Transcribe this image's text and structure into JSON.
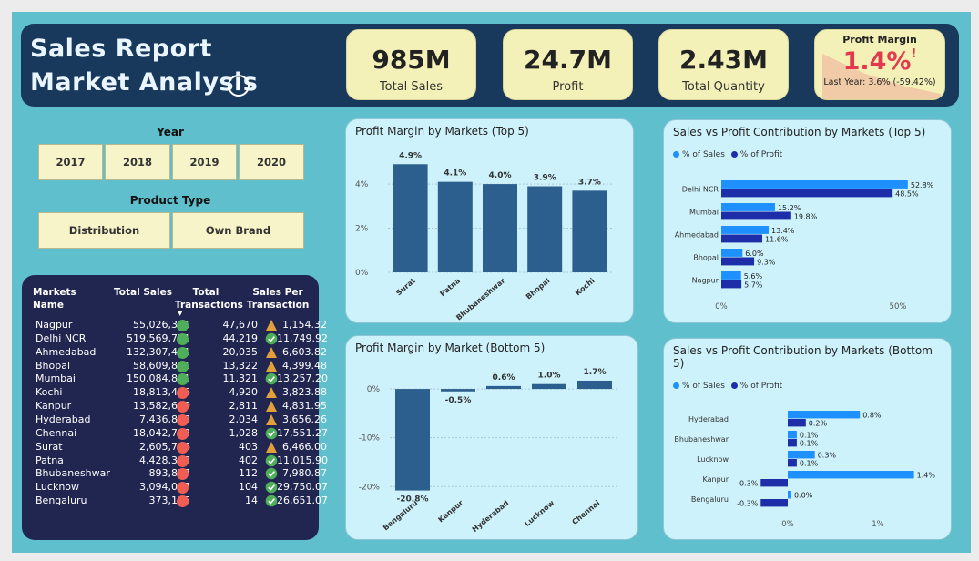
{
  "header": {
    "title_line1": "Sales Report",
    "title_line2": "Market Analysis",
    "info_icon": "i"
  },
  "kpis": [
    {
      "value": "985M",
      "label": "Total Sales"
    },
    {
      "value": "24.7M",
      "label": "Profit"
    },
    {
      "value": "2.43M",
      "label": "Total Quantity"
    }
  ],
  "profit_margin_card": {
    "title": "Profit Margin",
    "value": "1.4%",
    "alert": "!",
    "last_year": "Last Year: 3.6% (-59.42%)"
  },
  "year_slicer": {
    "title": "Year",
    "options": [
      "2017",
      "2018",
      "2019",
      "2020"
    ]
  },
  "product_slicer": {
    "title": "Product Type",
    "options": [
      "Distribution",
      "Own Brand"
    ]
  },
  "markets_table": {
    "headers": {
      "name": "Markets Name",
      "sales": "Total Sales",
      "tx": "Total Transactions",
      "spt": "Sales Per Transaction"
    },
    "sort_indicator": "▼",
    "rows": [
      {
        "name": "Nagpur",
        "sales": "55,026,321",
        "dot": "green",
        "tx": "47,670",
        "icon": "warning",
        "spt": "1,154.32"
      },
      {
        "name": "Delhi NCR",
        "sales": "519,569,771",
        "dot": "green",
        "tx": "44,219",
        "icon": "check",
        "spt": "11,749.92"
      },
      {
        "name": "Ahmedabad",
        "sales": "132,307,441",
        "dot": "green",
        "tx": "20,035",
        "icon": "warning",
        "spt": "6,603.82"
      },
      {
        "name": "Bhopal",
        "sales": "58,609,861",
        "dot": "green",
        "tx": "13,322",
        "icon": "warning",
        "spt": "4,399.48"
      },
      {
        "name": "Mumbai",
        "sales": "150,084,801",
        "dot": "green",
        "tx": "11,321",
        "icon": "check",
        "spt": "13,257.20"
      },
      {
        "name": "Kochi",
        "sales": "18,813,466",
        "dot": "red",
        "tx": "4,920",
        "icon": "warning",
        "spt": "3,823.88"
      },
      {
        "name": "Kanpur",
        "sales": "13,582,609",
        "dot": "red",
        "tx": "2,811",
        "icon": "warning",
        "spt": "4,831.95"
      },
      {
        "name": "Hyderabad",
        "sales": "7,436,823",
        "dot": "red",
        "tx": "2,034",
        "icon": "warning",
        "spt": "3,656.26"
      },
      {
        "name": "Chennai",
        "sales": "18,042,702",
        "dot": "red",
        "tx": "1,028",
        "icon": "check",
        "spt": "17,551.27"
      },
      {
        "name": "Surat",
        "sales": "2,605,796",
        "dot": "red",
        "tx": "403",
        "icon": "warning",
        "spt": "6,466.00"
      },
      {
        "name": "Patna",
        "sales": "4,428,393",
        "dot": "red",
        "tx": "402",
        "icon": "check",
        "spt": "11,015.90"
      },
      {
        "name": "Bhubaneshwar",
        "sales": "893,857",
        "dot": "red",
        "tx": "112",
        "icon": "check",
        "spt": "7,980.87"
      },
      {
        "name": "Lucknow",
        "sales": "3,094,007",
        "dot": "red",
        "tx": "104",
        "icon": "check",
        "spt": "29,750.07"
      },
      {
        "name": "Bengaluru",
        "sales": "373,115",
        "dot": "red",
        "tx": "14",
        "icon": "check",
        "spt": "26,651.07"
      }
    ]
  },
  "colors": {
    "green": "#4fae59",
    "red": "#f25d53",
    "warning": "#e1a03a",
    "check": "#4fae59",
    "bar": "#2d5f8e",
    "sales": "#1e90ff",
    "profit": "#1e2ea8"
  },
  "chart_data": [
    {
      "type": "bar",
      "title": "Profit Margin by Markets (Top 5)",
      "categories": [
        "Surat",
        "Patna",
        "Bhubaneshwar",
        "Bhopal",
        "Kochi"
      ],
      "values": [
        4.9,
        4.1,
        4.0,
        3.9,
        3.7
      ],
      "labels": [
        "4.9%",
        "4.1%",
        "4.0%",
        "3.9%",
        "3.7%"
      ],
      "yticks": [
        "0%",
        "2%",
        "4%"
      ],
      "ylim": [
        0,
        5.2
      ]
    },
    {
      "type": "bar",
      "title": "Profit Margin by Market (Bottom 5)",
      "categories": [
        "Bengaluru",
        "Kanpur",
        "Hyderabad",
        "Lucknow",
        "Chennai"
      ],
      "values": [
        -20.8,
        -0.5,
        0.6,
        1.0,
        1.7
      ],
      "labels": [
        "-20.8%",
        "-0.5%",
        "0.6%",
        "1.0%",
        "1.7%"
      ],
      "yticks": [
        "0%",
        "-10%",
        "-20%"
      ],
      "ylim": [
        -22,
        3
      ]
    },
    {
      "type": "bar",
      "title": "Sales vs Profit Contribution by Markets (Top 5)",
      "categories": [
        "Delhi NCR",
        "Mumbai",
        "Ahmedabad",
        "Bhopal",
        "Nagpur"
      ],
      "series": [
        {
          "name": "% of Sales",
          "values": [
            52.8,
            15.2,
            13.4,
            6.0,
            5.6
          ],
          "labels": [
            "52.8%",
            "15.2%",
            "13.4%",
            "6.0%",
            "5.6%"
          ]
        },
        {
          "name": "% of Profit",
          "values": [
            48.5,
            19.8,
            11.6,
            9.3,
            5.7
          ],
          "labels": [
            "48.5%",
            "19.8%",
            "11.6%",
            "9.3%",
            "5.7%"
          ]
        }
      ],
      "xticks": [
        "0%",
        "50%"
      ],
      "xlim": [
        0,
        50
      ]
    },
    {
      "type": "bar",
      "title": "Sales vs Profit Contribution by Markets (Bottom 5)",
      "categories": [
        "Hyderabad",
        "Bhubaneshwar",
        "Lucknow",
        "Kanpur",
        "Bengaluru"
      ],
      "series": [
        {
          "name": "% of Sales",
          "values": [
            0.8,
            0.1,
            0.3,
            1.4,
            0.04
          ],
          "labels": [
            "0.8%",
            "0.1%",
            "0.3%",
            "1.4%",
            "0.0%"
          ]
        },
        {
          "name": "% of Profit",
          "values": [
            0.2,
            0.1,
            0.1,
            -0.3,
            -0.3
          ],
          "labels": [
            "0.2%",
            "0.1%",
            "0.1%",
            "-0.3%",
            "-0.3%"
          ]
        }
      ],
      "xticks": [
        "0%",
        "1%"
      ],
      "xlim": [
        0,
        1
      ]
    }
  ]
}
